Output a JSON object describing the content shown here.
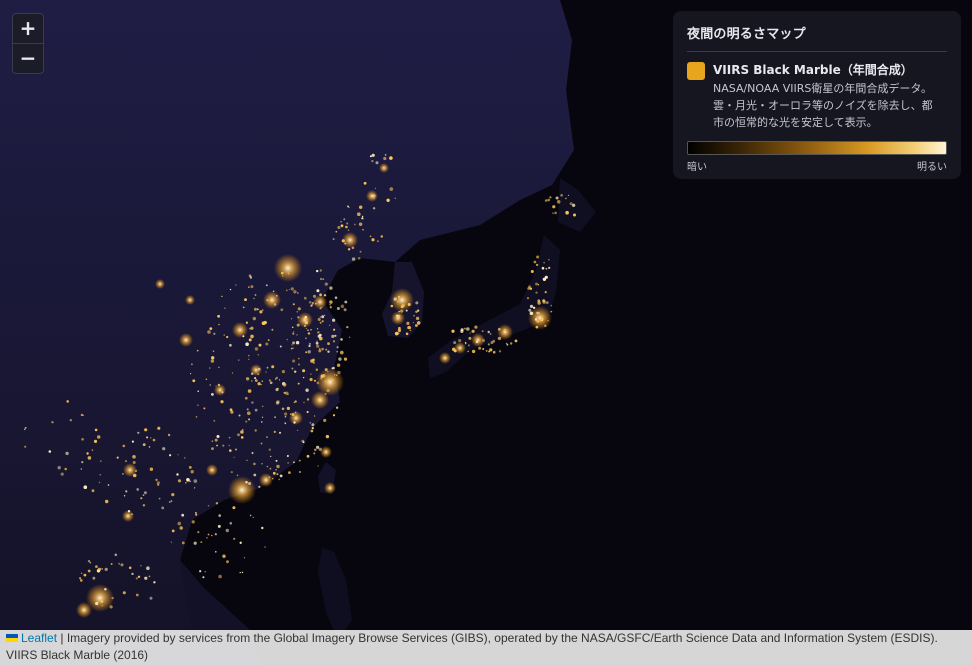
{
  "map": {
    "zoom_in_label": "+",
    "zoom_out_label": "−",
    "colors": {
      "ocean": "#07060f",
      "land": "#14132b",
      "light": "#ffc75a"
    }
  },
  "legend": {
    "title": "夜間の明るさマップ",
    "layer_name": "VIIRS Black Marble（年間合成）",
    "layer_desc_line1": "NASA/NOAA VIIRS衛星の年間合成データ。",
    "layer_desc_line2": "雲・月光・オーロラ等のノイズを除去し、都",
    "layer_desc_line3": "市の恒常的な光を安定して表示。",
    "swatch_color": "#e6a51d",
    "scale_low": "暗い",
    "scale_high": "明るい"
  },
  "attribution": {
    "leaflet": "Leaflet",
    "separator": " | ",
    "line1": "Imagery provided by services from the Global Imagery Browse Services (GIBS), operated by the NASA/GSFC/Earth Science Data and Information System (ESDIS).",
    "line2": "VIIRS Black Marble (2016)"
  }
}
